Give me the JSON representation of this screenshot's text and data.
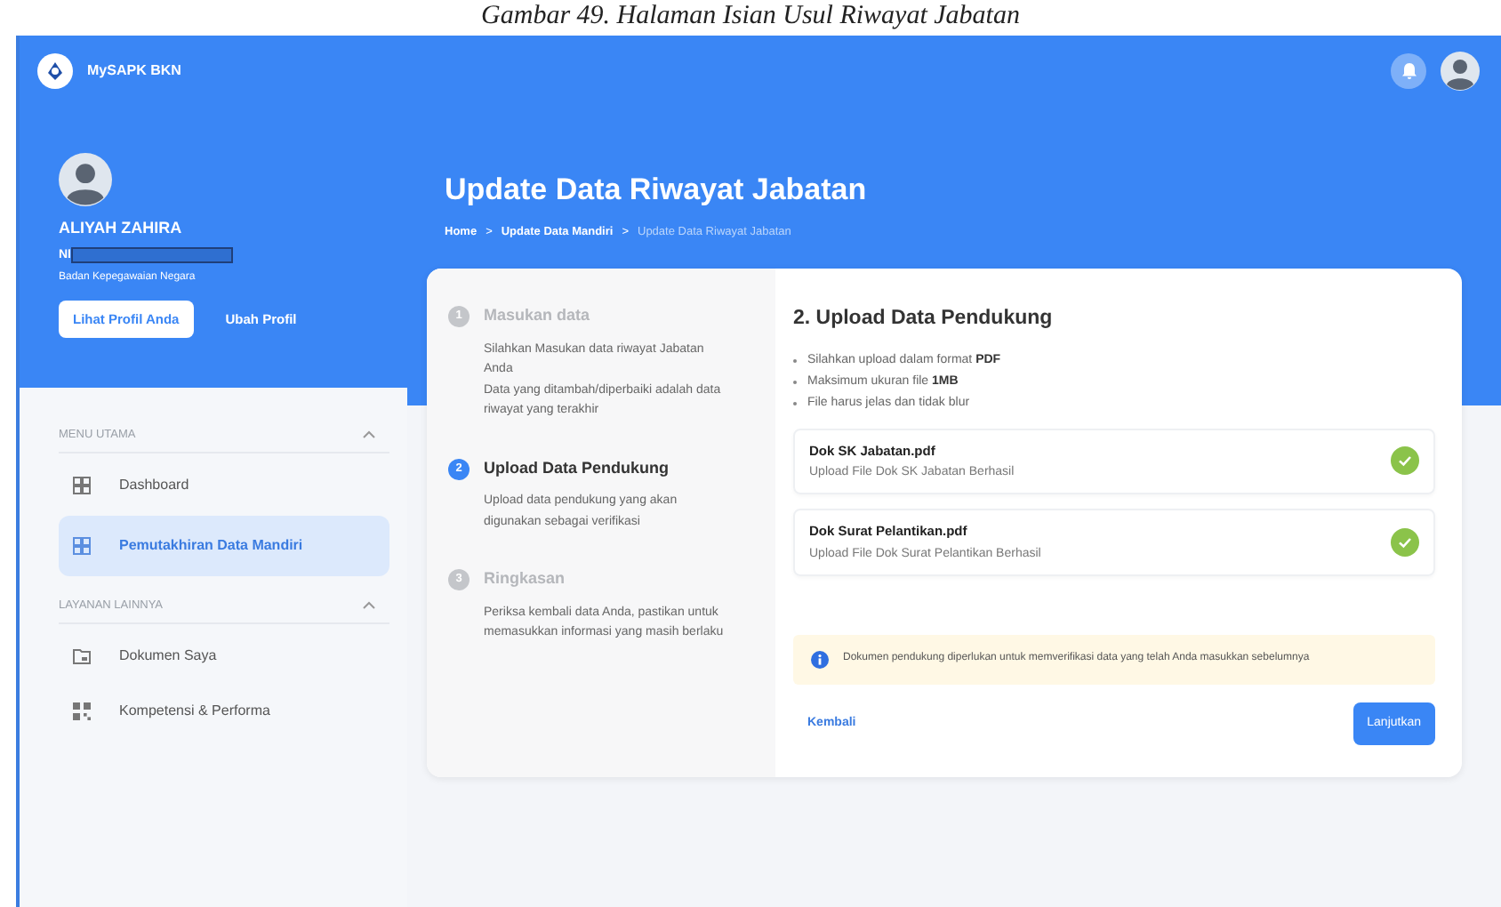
{
  "document_caption": "Gambar 49. Halaman Isian Usul Riwayat Jabatan",
  "topbar": {
    "app_name": "MySAPK BKN"
  },
  "profile": {
    "name": "ALIYAH ZAHIRA",
    "id_label": "NI",
    "organization": "Badan Kepegawaian Negara",
    "primary_button": "Lihat Profil Anda",
    "secondary_button": "Ubah Profil"
  },
  "sidebar": {
    "sections": [
      {
        "title": "MENU UTAMA",
        "expanded": true,
        "items": [
          {
            "label": "Dashboard",
            "selected": false
          },
          {
            "label": "Pemutakhiran Data Mandiri",
            "selected": true
          }
        ]
      },
      {
        "title": "LAYANAN LAINNYA",
        "expanded": true,
        "items": [
          {
            "label": "Dokumen Saya",
            "selected": false
          },
          {
            "label": "Kompetensi & Performa",
            "selected": false
          }
        ]
      }
    ]
  },
  "page_title": "Update Data Riwayat Jabatan",
  "breadcrumb": [
    {
      "kind": "link",
      "text": "Home"
    },
    {
      "kind": "separator",
      "text": ">"
    },
    {
      "kind": "link",
      "text": "Update Data Mandiri"
    },
    {
      "kind": "separator",
      "text": ">"
    },
    {
      "kind": "current",
      "text": "Update Data Riwayat Jabatan"
    }
  ],
  "steps": [
    {
      "number": "1",
      "title": "Masukan data",
      "selected": false,
      "paragraphs": [
        "Silahkan Masukan data riwayat Jabatan Anda",
        "Data yang ditambah/diperbaiki adalah data riwayat yang terakhir"
      ]
    },
    {
      "number": "2",
      "title": "Upload Data Pendukung",
      "selected": true,
      "paragraphs": [
        "Upload data pendukung yang akan digunakan sebagai verifikasi"
      ]
    },
    {
      "number": "3",
      "title": "Ringkasan",
      "selected": false,
      "paragraphs": [
        "Periksa kembali data Anda, pastikan untuk memasukkan informasi yang masih berlaku"
      ]
    }
  ],
  "upload": {
    "heading": "2. Upload Data Pendukung",
    "rules": [
      "Silahkan upload dalam format **PDF**",
      "Maksimum ukuran file **1MB**",
      "File harus jelas dan tidak blur"
    ],
    "files": [
      {
        "name": "Dok SK Jabatan.pdf",
        "status": "Upload File Dok SK Jabatan Berhasil",
        "uploaded": true
      },
      {
        "name": "Dok Surat Pelantikan.pdf",
        "status": "Upload File Dok Surat Pelantikan Berhasil",
        "uploaded": true
      }
    ],
    "notice": "Dokumen pendukung diperlukan untuk memverifikasi data yang telah Anda masukkan sebelumnya",
    "back_button": "Kembali",
    "next_button": "Lanjutkan"
  }
}
